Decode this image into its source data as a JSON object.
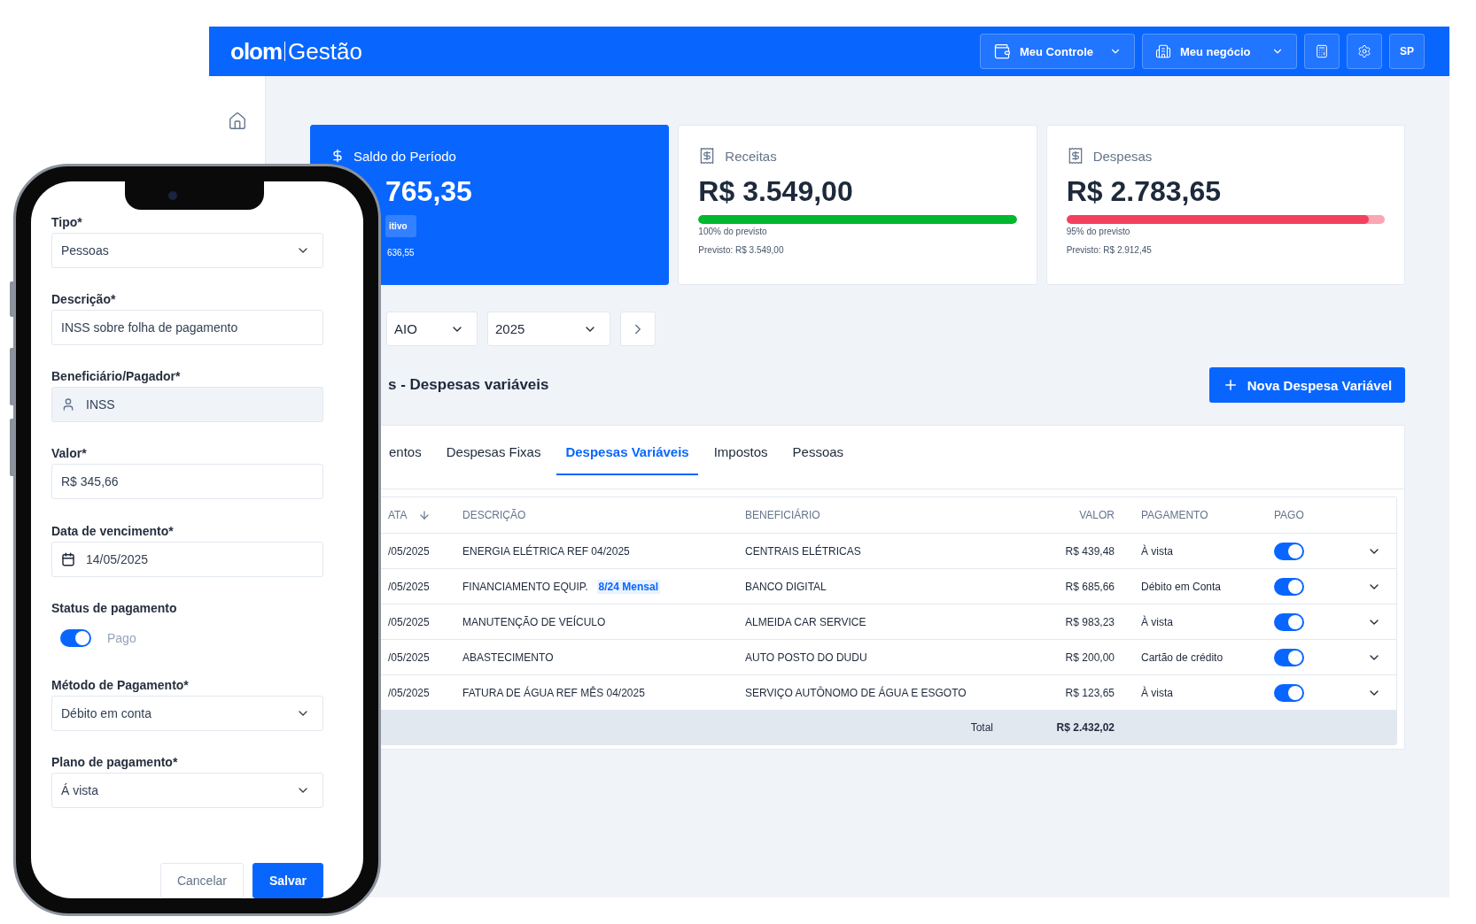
{
  "app": {
    "logo_left": "olom",
    "logo_right": "Gestão"
  },
  "header_menus": [
    {
      "label": "Meu Controle",
      "kind": "wallet"
    },
    {
      "label": "Meu negócio",
      "kind": "building"
    }
  ],
  "user": {
    "initials": "SP"
  },
  "summary_cards": [
    {
      "kind": "balance",
      "title": "Saldo do Período",
      "amount": "765,35",
      "badge": "itivo",
      "note": "636,55"
    },
    {
      "kind": "income",
      "title": "Receitas",
      "amount": "R$ 3.549,00",
      "level": 1.0,
      "progress_label": "100% do previsto",
      "expected": "Previsto: R$ 3.549,00"
    },
    {
      "kind": "expense",
      "title": "Despesas",
      "amount": "R$ 2.783,65",
      "level": 0.95,
      "progress_label": "95% do previsto",
      "expected": "Previsto: R$ 2.912,45"
    }
  ],
  "filters": {
    "month": "AIO",
    "year": "2025"
  },
  "section_title": "s - Despesas variáveis",
  "new_button": "Nova Despesa Variável",
  "tabs": [
    {
      "label": "entos",
      "selected": false
    },
    {
      "label": "Despesas Fixas",
      "selected": false
    },
    {
      "label": "Despesas Variáveis",
      "selected": true
    },
    {
      "label": "Impostos",
      "selected": false
    },
    {
      "label": "Pessoas",
      "selected": false
    }
  ],
  "table": {
    "columns": [
      "ATA",
      "DESCRIÇÃO",
      "BENEFICIÁRIO",
      "VALOR",
      "PAGAMENTO",
      "PAGO"
    ],
    "rows": [
      {
        "date": "/05/2025",
        "description": "ENERGIA ELÉTRICA REF 04/2025",
        "beneficiary": "CENTRAIS ELÉTRICAS",
        "value": "R$ 439,48",
        "payment": "À vista",
        "paid": true
      },
      {
        "date": "/05/2025",
        "description": "FINANCIAMENTO EQUIP.",
        "tag": "8/24 Mensal",
        "beneficiary": "BANCO DIGITAL",
        "value": "R$ 685,66",
        "payment": "Débito em Conta",
        "paid": true
      },
      {
        "date": "/05/2025",
        "description": "MANUTENÇÃO DE VEÍCULO",
        "beneficiary": "ALMEIDA CAR SERVICE",
        "value": "R$ 983,23",
        "payment": "À vista",
        "paid": true
      },
      {
        "date": "/05/2025",
        "description": "ABASTECIMENTO",
        "beneficiary": "AUTO POSTO DO DUDU",
        "value": "R$ 200,00",
        "payment": "Cartão de crédito",
        "paid": true
      },
      {
        "date": "/05/2025",
        "description": "FATURA DE ÁGUA REF MÊS 04/2025",
        "beneficiary": "SERVIÇO AUTÔNOMO DE ÁGUA E ESGOTO",
        "value": "R$ 123,65",
        "payment": "À vista",
        "paid": true
      }
    ],
    "total_label": "Total",
    "total": "R$ 2.432,02"
  },
  "phone_form": {
    "fields": [
      {
        "kind": "select",
        "label": "Tipo*",
        "value": "Pessoas"
      },
      {
        "kind": "text",
        "label": "Descrição*",
        "value": "INSS sobre folha de pagamento"
      },
      {
        "kind": "person",
        "label": "Beneficiário/Pagador*",
        "value": "INSS"
      },
      {
        "kind": "text",
        "label": "Valor*",
        "value": "R$ 345,66"
      },
      {
        "kind": "date",
        "label": "Data de vencimento*",
        "value": "14/05/2025"
      },
      {
        "kind": "toggle",
        "label": "Status de pagamento",
        "value": "Pago",
        "on": true
      },
      {
        "kind": "select",
        "label": "Método de Pagamento*",
        "value": "Débito em conta"
      },
      {
        "kind": "select",
        "label": "Plano de pagamento*",
        "value": "Á vista"
      }
    ],
    "buttons": [
      {
        "label": "Cancelar",
        "kind": "secondary"
      },
      {
        "label": "Salvar",
        "kind": "primary"
      }
    ]
  }
}
